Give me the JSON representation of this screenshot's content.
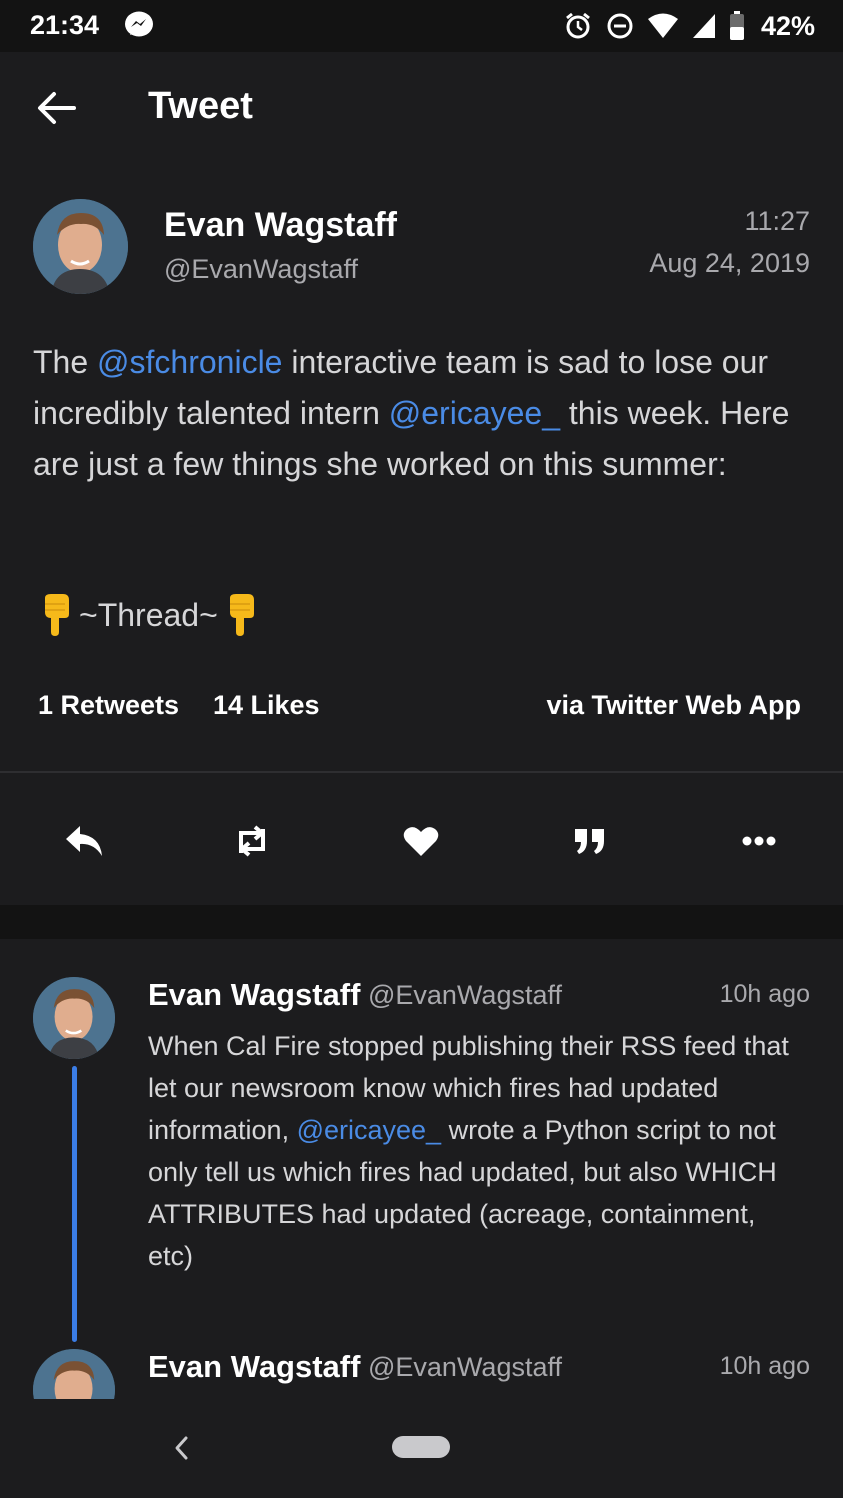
{
  "status_bar": {
    "time": "21:34",
    "battery": "42%",
    "icons": [
      "messenger-icon",
      "alarm-icon",
      "do-not-disturb-icon",
      "wifi-icon",
      "signal-icon",
      "battery-icon"
    ]
  },
  "app_bar": {
    "title": "Tweet",
    "back_icon": "arrow-left-icon"
  },
  "tweet": {
    "author_name": "Evan Wagstaff",
    "author_handle": "@EvanWagstaff",
    "time": "11:27",
    "date": "Aug 24, 2019",
    "body": {
      "p1": "The ",
      "m1": "@sfchronicle",
      "p2": " interactive team is sad to lose our incredibly talented intern ",
      "m2": "@ericayee_",
      "p3": " this week. Here are just a few things she worked on this summer:"
    },
    "thread_label": "~Thread~",
    "retweets": "1 Retweets",
    "likes": "14 Likes",
    "via": "via Twitter Web App"
  },
  "actions": {
    "icons": [
      "reply-icon",
      "retweet-icon",
      "heart-icon",
      "quote-icon",
      "more-icon"
    ]
  },
  "replies": [
    {
      "name": "Evan Wagstaff",
      "handle": "@EvanWagstaff",
      "time": "10h ago",
      "body": {
        "p1": "When Cal Fire stopped publishing their RSS feed that let our newsroom know which fires had updated information, ",
        "m1": "@ericayee_",
        "p2": " wrote a Python script to not only tell us which fires had updated, but also WHICH ATTRIBUTES had updated (acreage, containment, etc)"
      }
    },
    {
      "name": "Evan Wagstaff",
      "handle": "@EvanWagstaff",
      "time": "10h ago"
    }
  ],
  "nav_bar": {
    "icons": [
      "nav-back-icon",
      "home-pill-icon"
    ]
  },
  "colors": {
    "background": "#1c1c1e",
    "mention": "#4a8be5",
    "thread_connector": "#3b7de6"
  }
}
